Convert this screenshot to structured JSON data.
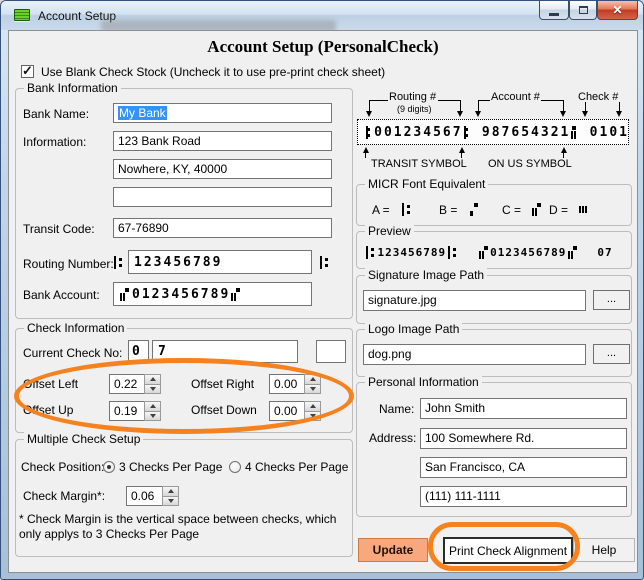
{
  "colors": {
    "annotation_orange": "#F5821F",
    "update_button_bg": "#F9A87D",
    "selection_blue": "#3094FA",
    "close_button_red": "#C23A22"
  },
  "icons": {
    "close": "✕",
    "checkmark": "✓",
    "app_icon": "green-check-stack"
  },
  "window": {
    "title": "Account Setup"
  },
  "heading": "Account Setup (PersonalCheck)",
  "stock_checkbox": {
    "label": "Use Blank Check Stock (Uncheck it to use pre-print check sheet)",
    "checked": true
  },
  "bank_info": {
    "title": "Bank Information",
    "bank_name": {
      "label": "Bank Name:",
      "value": "My Bank"
    },
    "information": {
      "label": "Information:",
      "line1": "123 Bank Road",
      "line2": "Nowhere, KY, 40000",
      "line3": ""
    },
    "transit_code": {
      "label": "Transit Code:",
      "value": "67-76890"
    },
    "routing": {
      "label": "Routing Number:",
      "value": "123456789",
      "left_symbol": "⑆",
      "right_symbol": "⑆"
    },
    "account": {
      "label": "Bank Account:",
      "value": "⑈0123456789⑈"
    }
  },
  "check_info": {
    "title": "Check Information",
    "current_check_no": {
      "label": "Current Check No:",
      "prefix": "0",
      "value": "7",
      "suffix": ""
    },
    "offset_left": {
      "label": "Offset Left",
      "value": "0.22"
    },
    "offset_right": {
      "label": "Offset Right",
      "value": "0.00"
    },
    "offset_up": {
      "label": "Offset Up",
      "value": "0.19"
    },
    "offset_down": {
      "label": "Offset Down",
      "value": "0.00"
    }
  },
  "multi_check": {
    "title": "Multiple Check Setup",
    "position_label": "Check Position:",
    "option3": "3 Checks Per Page",
    "option3_selected": true,
    "option4": "4 Checks Per Page",
    "option4_selected": false,
    "margin_label": "Check Margin*:",
    "margin_value": "0.06",
    "note_line1": "* Check Margin is the vertical space between checks, which",
    "note_line2": "only applys to 3 Checks Per Page"
  },
  "diagram": {
    "routing_label": "Routing #",
    "routing_sub": "(9 digits)",
    "account_label": "Account #",
    "check_label": "Check #",
    "micr_line": "⑆001234567⑆  987654321⑈  0101",
    "transit_symbol_label": "TRANSIT SYMBOL",
    "onus_symbol_label": "ON US SYMBOL"
  },
  "micr_equiv": {
    "title": "MICR Font Equivalent",
    "a_label": "A =",
    "a_symbol": "⑆",
    "b_label": "B =",
    "b_symbol": "⑇",
    "c_label": "C =",
    "c_symbol": "⑈",
    "d_label": "D =",
    "d_symbol": "⑉"
  },
  "preview": {
    "title": "Preview",
    "content": "⑆123456789⑆  ⑈0123456789⑈  07"
  },
  "signature": {
    "title": "Signature Image Path",
    "value": "signature.jpg",
    "browse": "..."
  },
  "logo": {
    "title": "Logo Image Path",
    "value": "dog.png",
    "browse": "..."
  },
  "personal": {
    "title": "Personal Information",
    "name_label": "Name:",
    "name": "John Smith",
    "address_label": "Address:",
    "address1": "100 Somewhere Rd.",
    "address2": "San Francisco, CA",
    "address3": "(111) 111-1111"
  },
  "buttons": {
    "update": "Update",
    "print_alignment": "Print Check Alignment",
    "help": "Help"
  }
}
